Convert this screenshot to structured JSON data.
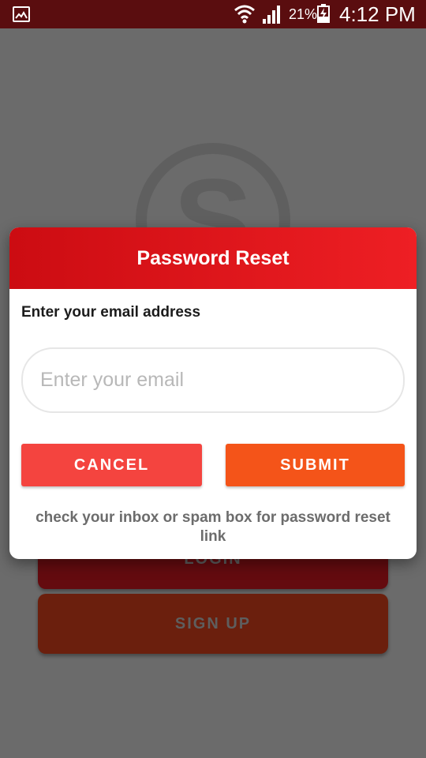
{
  "status_bar": {
    "battery_percent": "21%",
    "time": "4:12 PM",
    "icons": [
      "gallery-icon",
      "wifi-icon",
      "signal-icon",
      "battery-charging-icon"
    ]
  },
  "background": {
    "logo_letter": "S",
    "login_label": "LOGIN",
    "signup_label": "SIGN UP"
  },
  "dialog": {
    "title": "Password Reset",
    "label": "Enter your email address",
    "email_placeholder": "Enter your email",
    "email_value": "",
    "cancel_label": "CANCEL",
    "submit_label": "SUBMIT",
    "note": "check your inbox or spam box for password reset link"
  },
  "colors": {
    "status_bar": "#5a0d0f",
    "header_start": "#cc0c12",
    "header_end": "#ee1f24",
    "cancel": "#f4443f",
    "submit": "#f45419"
  }
}
